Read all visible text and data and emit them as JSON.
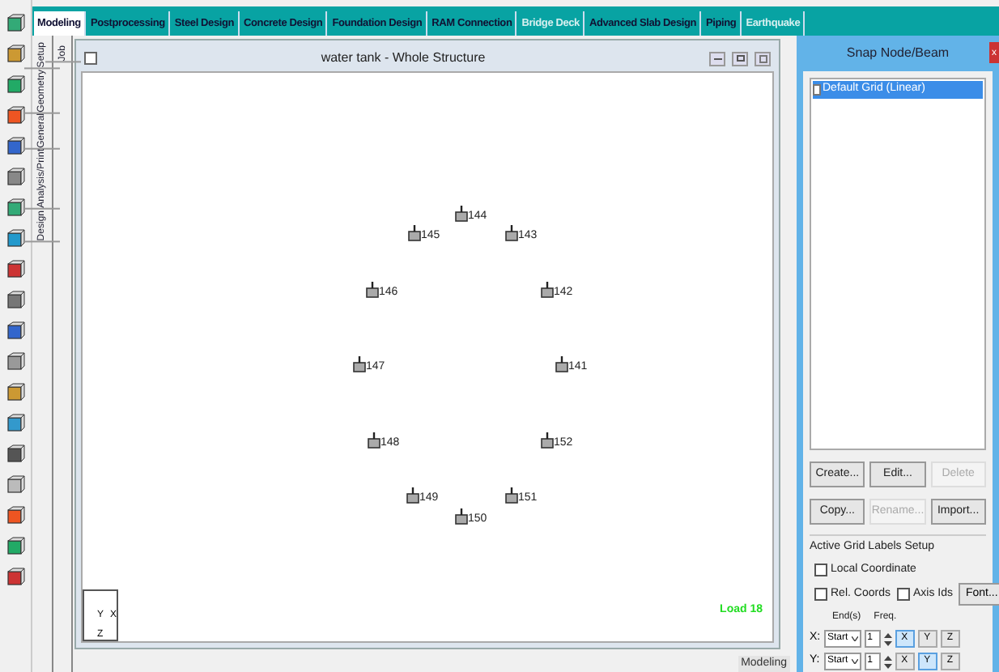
{
  "tabs": [
    {
      "label": "Modeling",
      "selected": true,
      "disabled": false
    },
    {
      "label": "Postprocessing",
      "selected": false,
      "disabled": false
    },
    {
      "label": "Steel Design",
      "selected": false,
      "disabled": false
    },
    {
      "label": "Concrete Design",
      "selected": false,
      "disabled": false
    },
    {
      "label": "Foundation Design",
      "selected": false,
      "disabled": false
    },
    {
      "label": "RAM Connection",
      "selected": false,
      "disabled": false
    },
    {
      "label": "Bridge Deck",
      "selected": false,
      "disabled": true
    },
    {
      "label": "Advanced Slab Design",
      "selected": false,
      "disabled": false
    },
    {
      "label": "Piping",
      "selected": false,
      "disabled": false
    },
    {
      "label": "Earthquake",
      "selected": false,
      "disabled": true
    }
  ],
  "side_tabs": [
    "Setup",
    "Geometry",
    "General",
    "Analysis/Print",
    "Design"
  ],
  "job_tab": "Job",
  "viewport": {
    "title": "water tank - Whole Structure",
    "nodes": [
      "144",
      "145",
      "143",
      "146",
      "142",
      "147",
      "141",
      "148",
      "152",
      "149",
      "151",
      "150"
    ],
    "load_label": "Load 18",
    "axis_labels": [
      "Y",
      "X",
      "Z"
    ]
  },
  "snap_panel": {
    "title": "Snap Node/Beam",
    "close": "x",
    "grids": [
      {
        "label": "Default Grid (Linear)",
        "selected": true,
        "checked": false
      }
    ],
    "buttons": [
      {
        "label": "Create...",
        "disabled": false
      },
      {
        "label": "Edit...",
        "disabled": false
      },
      {
        "label": "Delete",
        "disabled": true
      },
      {
        "label": "Copy...",
        "disabled": false
      },
      {
        "label": "Rename...",
        "disabled": true
      },
      {
        "label": "Import...",
        "disabled": false
      }
    ],
    "group_title": "Active Grid Labels Setup",
    "options": [
      {
        "label": "Local Coordinate",
        "checked": false
      },
      {
        "label": "Rel. Coords",
        "checked": false
      },
      {
        "label": "Axis Ids",
        "checked": false
      }
    ],
    "font_button": "Font...",
    "col_headers": [
      "End(s)",
      "Freq."
    ],
    "rows": [
      {
        "axis": "X:",
        "end": "Start",
        "freq": "1",
        "toggles": [
          {
            "label": "X",
            "selected": true
          },
          {
            "label": "Y",
            "selected": false
          },
          {
            "label": "Z",
            "selected": false
          }
        ]
      },
      {
        "axis": "Y:",
        "end": "Start",
        "freq": "1",
        "toggles": [
          {
            "label": "X",
            "selected": false
          },
          {
            "label": "Y",
            "selected": true
          },
          {
            "label": "Z",
            "selected": false
          }
        ]
      }
    ]
  },
  "status_bar": {
    "mode": "Modeling"
  }
}
